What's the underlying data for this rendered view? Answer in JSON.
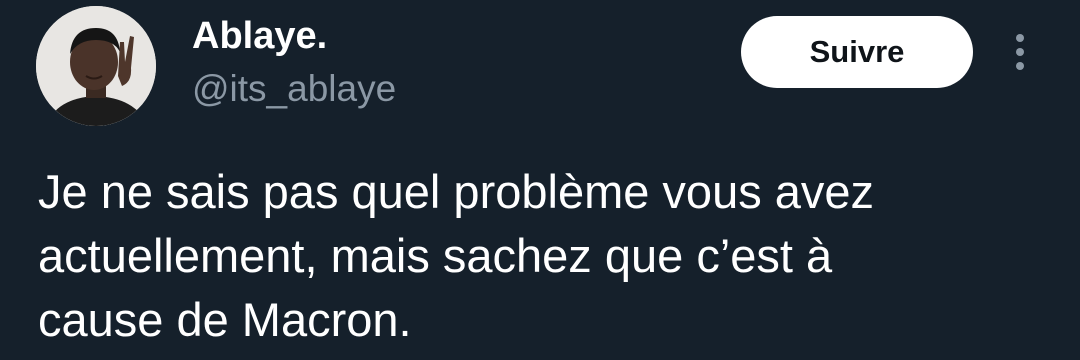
{
  "user": {
    "display_name": "Ablaye.",
    "handle": "@its_ablaye",
    "avatar_icon": "profile-photo"
  },
  "actions": {
    "follow_label": "Suivre",
    "more_icon": "vertical-dots-icon"
  },
  "tweet": {
    "text": "Je ne sais pas quel problème vous avez\nactuellement, mais sachez que c’est à\ncause de Macron."
  },
  "colors": {
    "background": "#15202b",
    "primary_text": "#ffffff",
    "secondary_text": "#8b98a5",
    "button_bg": "#ffffff",
    "button_text": "#0f1419"
  }
}
